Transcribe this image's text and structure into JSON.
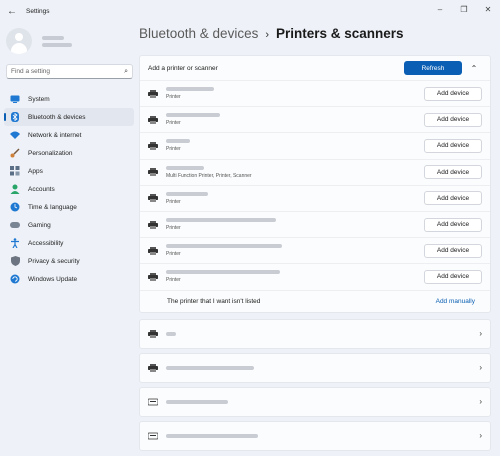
{
  "window": {
    "title": "Settings",
    "back_icon": "back-arrow-icon",
    "controls": [
      "minimize-icon",
      "maximize-icon",
      "close-icon"
    ]
  },
  "sidebar": {
    "search_placeholder": "Find a setting",
    "items": [
      {
        "label": "System",
        "icon": "system-icon",
        "color": "#1f78d1"
      },
      {
        "label": "Bluetooth & devices",
        "icon": "bluetooth-icon",
        "color": "#1f78d1",
        "active": true
      },
      {
        "label": "Network & internet",
        "icon": "wifi-icon",
        "color": "#1f78d1"
      },
      {
        "label": "Personalization",
        "icon": "brush-icon",
        "color": "#d1803a"
      },
      {
        "label": "Apps",
        "icon": "apps-icon",
        "color": "#5a6f85"
      },
      {
        "label": "Accounts",
        "icon": "person-icon",
        "color": "#2aa56a"
      },
      {
        "label": "Time & language",
        "icon": "globe-clock-icon",
        "color": "#1f78d1"
      },
      {
        "label": "Gaming",
        "icon": "gamepad-icon",
        "color": "#7a8594"
      },
      {
        "label": "Accessibility",
        "icon": "accessibility-icon",
        "color": "#1f78d1"
      },
      {
        "label": "Privacy & security",
        "icon": "shield-icon",
        "color": "#6b7480"
      },
      {
        "label": "Windows Update",
        "icon": "update-icon",
        "color": "#1f78d1"
      }
    ]
  },
  "breadcrumb": {
    "parent": "Bluetooth & devices",
    "separator": "›",
    "current": "Printers & scanners"
  },
  "add_printer": {
    "label": "Add a printer or scanner",
    "refresh_label": "Refresh",
    "printers": [
      {
        "type": "Printer",
        "button": "Add device"
      },
      {
        "type": "Printer",
        "button": "Add device"
      },
      {
        "type": "Printer",
        "button": "Add device"
      },
      {
        "type": "Multi Function Printer, Printer, Scanner",
        "button": "Add device"
      },
      {
        "type": "Printer",
        "button": "Add device"
      },
      {
        "type": "Printer",
        "button": "Add device"
      },
      {
        "type": "Printer",
        "button": "Add device"
      },
      {
        "type": "Printer",
        "button": "Add device"
      }
    ],
    "not_listed_text": "The printer that I want isn't listed",
    "add_manually_label": "Add manually"
  },
  "accent_color": "#0a5fb4"
}
